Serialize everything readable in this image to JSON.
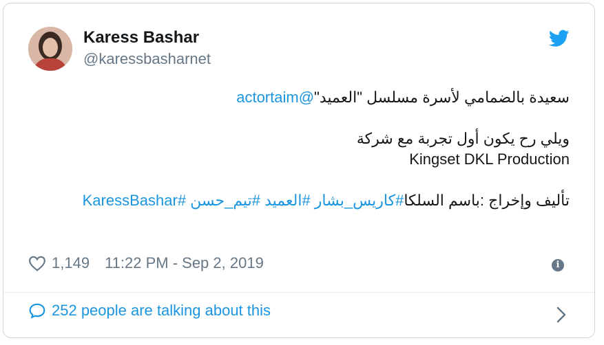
{
  "tweet": {
    "author_name": "Karess Bashar",
    "author_handle": "@karessbasharnet",
    "body": {
      "line1_text": "سعيدة بالضمامي لأسرة مسلسل \"العميد\"",
      "line1_mention": "@actortaim",
      "line2": "ويلي رح يكون أول تجربة مع شركة",
      "line3": "Kingset DKL Production",
      "line4_text": "تأليف وإخراج :باسم السلكا",
      "line4_hashtags": "#كاريس_بشار #العميد #تيم_حسن #KaressBashar"
    },
    "likes": "1,149",
    "timestamp": "11:22 PM - Sep 2, 2019",
    "talking": "252 people are talking about this"
  },
  "icons": {
    "brand": "twitter-bird-icon",
    "like": "heart-icon",
    "info": "info-icon",
    "reply": "speech-bubble-icon",
    "more": "chevron-right-icon"
  },
  "colors": {
    "accent": "#1b95e0",
    "muted": "#657786",
    "border": "#ccd6dd"
  }
}
